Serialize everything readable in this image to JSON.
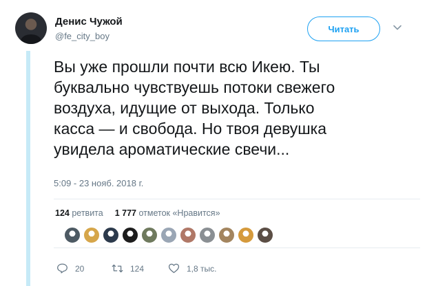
{
  "user": {
    "name": "Денис Чужой",
    "handle": "@fe_city_boy"
  },
  "follow_label": "Читать",
  "tweet": {
    "lines": [
      "Вы уже прошли почти всю Икею. Ты",
      "буквально чувствуешь потоки свежего",
      "воздуха, идущие от выхода. Только",
      "касса — и свобода. Но твоя девушка",
      "увидела ароматические свечи..."
    ],
    "timestamp": "5:09 - 23 нояб. 2018 г."
  },
  "stats": {
    "retweets_count": "124",
    "retweets_label": "ретвита",
    "likes_count": "1 777",
    "likes_label": "отметок «Нравится»"
  },
  "likers": [
    {
      "icon": "avatar-1",
      "color": "#4d5a63"
    },
    {
      "icon": "avatar-2",
      "color": "#d6a64a"
    },
    {
      "icon": "avatar-3",
      "color": "#2c3a4c"
    },
    {
      "icon": "avatar-4",
      "color": "#1d1d1d"
    },
    {
      "icon": "avatar-5",
      "color": "#6f7a5e"
    },
    {
      "icon": "avatar-6",
      "color": "#9aa6b5"
    },
    {
      "icon": "avatar-7",
      "color": "#b07867"
    },
    {
      "icon": "avatar-8",
      "color": "#8a8f93"
    },
    {
      "icon": "avatar-9",
      "color": "#a3855f"
    },
    {
      "icon": "avatar-10",
      "color": "#d59a3c"
    },
    {
      "icon": "avatar-11",
      "color": "#5b4e45"
    }
  ],
  "actions": {
    "reply_count": "20",
    "retweet_count": "124",
    "like_count": "1,8 тыс."
  },
  "colors": {
    "accent": "#1da1f2",
    "thread_line": "#c6eaf7",
    "muted": "#657786"
  }
}
